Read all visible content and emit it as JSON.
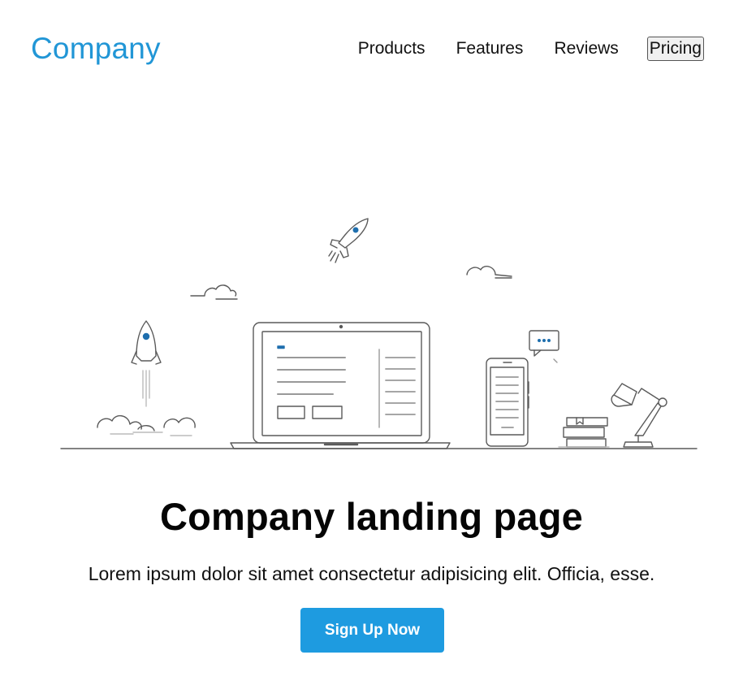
{
  "header": {
    "logo_text": "Company",
    "nav": [
      {
        "label": "Products"
      },
      {
        "label": "Features"
      },
      {
        "label": "Reviews"
      },
      {
        "label": "Pricing",
        "active": true
      }
    ]
  },
  "hero": {
    "title": "Company landing page",
    "subtitle": "Lorem ipsum dolor sit amet consectetur adipisicing elit. Officia, esse.",
    "cta_label": "Sign Up Now"
  },
  "colors": {
    "brand": "#2196d6",
    "button": "#1e9be0",
    "illustration_accent": "#1f6fae",
    "line": "#555555"
  }
}
